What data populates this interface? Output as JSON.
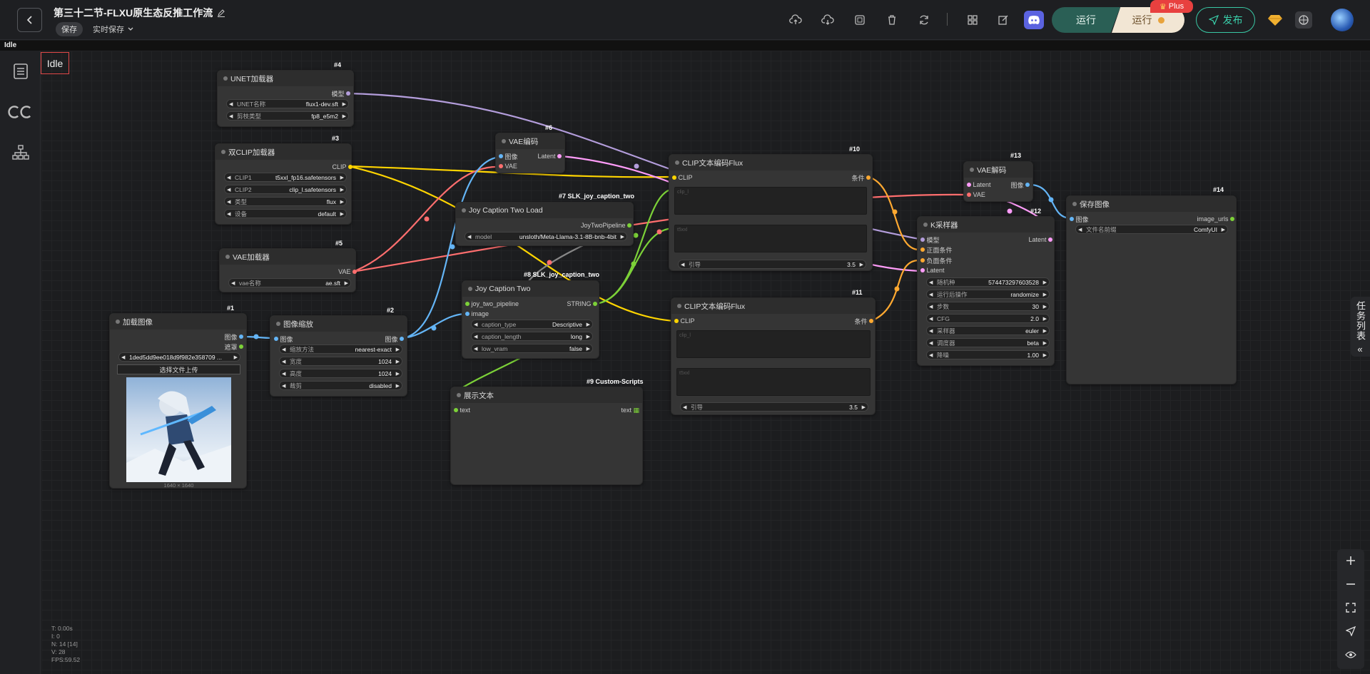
{
  "header": {
    "title": "第三十二节-FLXU原生态反推工作流",
    "save_badge": "保存",
    "autosave_label": "实时保存",
    "run_label": "运行",
    "run_plus_label": "运行",
    "plus_badge": "Plus",
    "publish_label": "发布"
  },
  "status": {
    "text": "Idle",
    "overlay": "Idle"
  },
  "right_tab": {
    "label": "任务列表"
  },
  "stats": {
    "t": "T: 0.00s",
    "i": "I: 0",
    "n": "N: 14 [14]",
    "v": "V: 28",
    "fps": "FPS:59.52"
  },
  "nodes": {
    "unet": {
      "id": "#4",
      "title": "UNET加载器",
      "out": "模型",
      "w1_label": "UNET名称",
      "w1_val": "flux1-dev.sft",
      "w2_label": "剪枝类型",
      "w2_val": "fp8_e5m2"
    },
    "dualclip": {
      "id": "#3",
      "title": "双CLIP加载器",
      "out": "CLIP",
      "w1_label": "CLIP1",
      "w1_val": "t5xxl_fp16.safetensors",
      "w2_label": "CLIP2",
      "w2_val": "clip_l.safetensors",
      "w3_label": "类型",
      "w3_val": "flux",
      "w4_label": "设备",
      "w4_val": "default"
    },
    "vaeloader": {
      "id": "#5",
      "title": "VAE加载器",
      "out": "VAE",
      "w1_label": "vae名称",
      "w1_val": "ae.sft"
    },
    "loadimage": {
      "id": "#1",
      "title": "加载图像",
      "out1": "图像",
      "out2": "遮罩",
      "file": "1ded5dd9ee018d9f982e358709 ...",
      "upload": "选择文件上传",
      "size": "1640 × 1640"
    },
    "scale": {
      "id": "#2",
      "title": "图像缩放",
      "in": "图像",
      "out": "图像",
      "w1_label": "缩放方法",
      "w1_val": "nearest-exact",
      "w2_label": "宽度",
      "w2_val": "1024",
      "w3_label": "高度",
      "w3_val": "1024",
      "w4_label": "裁剪",
      "w4_val": "disabled"
    },
    "vaeencode": {
      "id": "#6",
      "title": "VAE编码",
      "in1": "图像",
      "in2": "VAE",
      "out": "Latent"
    },
    "joyload": {
      "id": "#7 SLK_joy_caption_two",
      "title": "Joy Caption Two Load",
      "out": "JoyTwoPipeline",
      "w1_label": "model",
      "w1_val": "unsloth/Meta-Llama-3.1-8B-bnb-4bit"
    },
    "joytwo": {
      "id": "#8 SLK_joy_caption_two",
      "title": "Joy Caption Two",
      "in1": "joy_two_pipeline",
      "in2": "image",
      "out": "STRING",
      "w1_label": "caption_type",
      "w1_val": "Descriptive",
      "w2_label": "caption_length",
      "w2_val": "long",
      "w3_label": "low_vram",
      "w3_val": "false"
    },
    "showtext": {
      "id": "#9 Custom-Scripts",
      "title": "展示文本",
      "in": "text",
      "out": "text"
    },
    "clip10": {
      "id": "#10",
      "title": "CLIP文本编码Flux",
      "in": "CLIP",
      "out": "条件",
      "ph1": "clip_l",
      "ph2": "t5xxl",
      "w_label": "引导",
      "w_val": "3.5"
    },
    "clip11": {
      "id": "#11",
      "title": "CLIP文本编码Flux",
      "in": "CLIP",
      "out": "条件",
      "ph1": "clip_l",
      "ph2": "t5xxl",
      "w_label": "引导",
      "w_val": "3.5"
    },
    "vaedecode": {
      "id": "#13",
      "title": "VAE解码",
      "in1": "Latent",
      "in2": "VAE",
      "out": "图像"
    },
    "ksampler": {
      "id": "#12",
      "title": "K采样器",
      "in1": "模型",
      "in2": "正面条件",
      "in3": "负面条件",
      "in4": "Latent",
      "out": "Latent",
      "w1_label": "随机种",
      "w1_val": "574473297603528",
      "w2_label": "运行后操作",
      "w2_val": "randomize",
      "w3_label": "步数",
      "w3_val": "30",
      "w4_label": "CFG",
      "w4_val": "2.0",
      "w5_label": "采样器",
      "w5_val": "euler",
      "w6_label": "调度器",
      "w6_val": "beta",
      "w7_label": "降噪",
      "w7_val": "1.00"
    },
    "saveimage": {
      "id": "#14",
      "title": "保存图像",
      "in": "图像",
      "out": "image_urls",
      "w1_label": "文件名前缀",
      "w1_val": "ComfyUI"
    }
  },
  "colors": {
    "model": "#b39ddb",
    "clip": "#ffd500",
    "vae": "#ff6e6e",
    "image": "#64b5f6",
    "latent": "#ff9cf9",
    "cond": "#ffa931",
    "string": "#7cd138",
    "accent": "#3ad1ac"
  }
}
